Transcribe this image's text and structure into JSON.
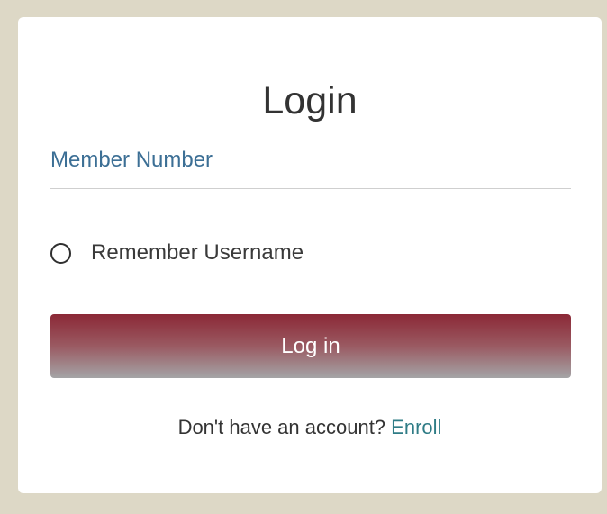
{
  "login_card": {
    "title": "Login",
    "member_field": {
      "label": "Member Number",
      "value": ""
    },
    "remember": {
      "label": "Remember Username",
      "checked": false
    },
    "login_button_label": "Log in",
    "enroll_prompt": "Don't have an account?",
    "enroll_link": "Enroll"
  },
  "colors": {
    "page_background": "#ddd8c6",
    "card_background": "#ffffff",
    "label_blue": "#3c6f95",
    "button_top": "#8b2836",
    "button_bottom": "#a4a4a6",
    "link_teal": "#2f7c86"
  }
}
